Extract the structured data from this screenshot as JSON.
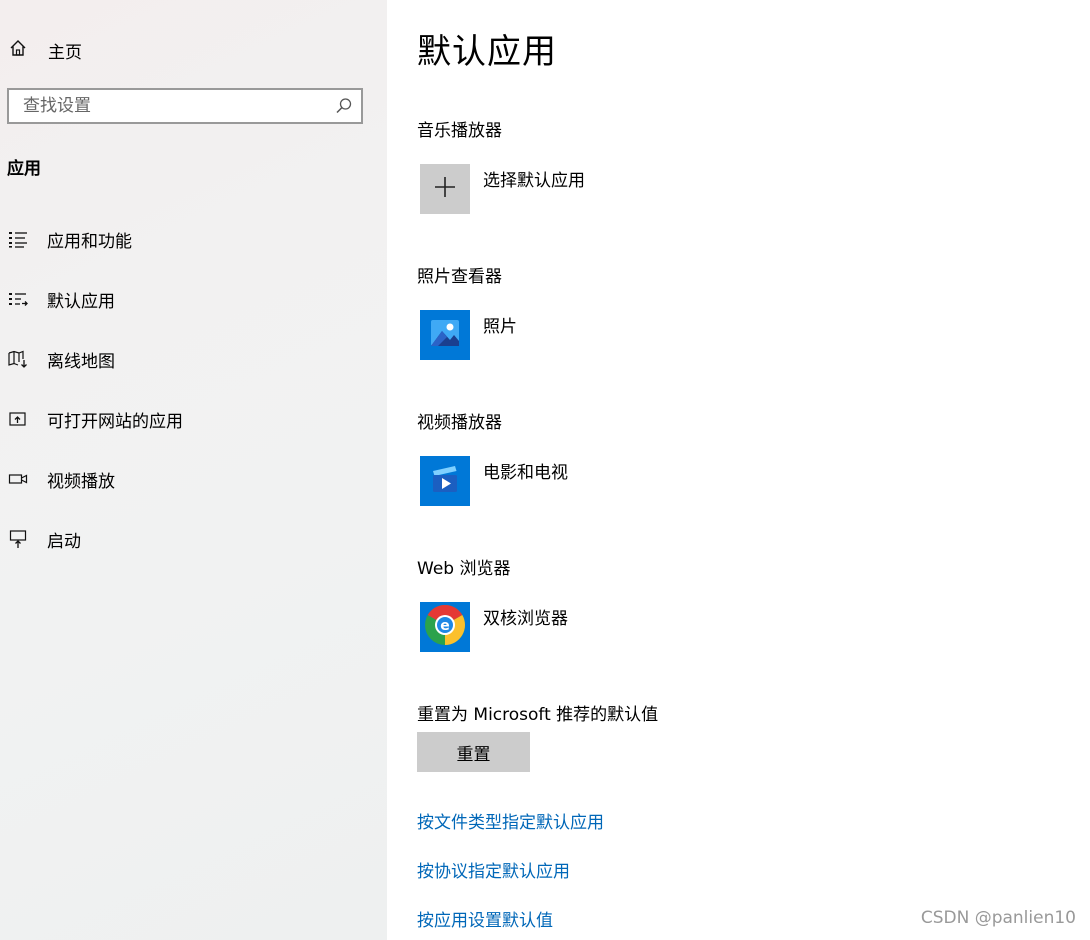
{
  "sidebar": {
    "home_label": "主页",
    "search_placeholder": "查找设置",
    "section_title": "应用",
    "items": [
      {
        "label": "应用和功能"
      },
      {
        "label": "默认应用"
      },
      {
        "label": "离线地图"
      },
      {
        "label": "可打开网站的应用"
      },
      {
        "label": "视频播放"
      },
      {
        "label": "启动"
      }
    ]
  },
  "main": {
    "title": "默认应用",
    "categories": [
      {
        "label": "音乐播放器",
        "app": "选择默认应用",
        "icon": "plus-icon"
      },
      {
        "label": "照片查看器",
        "app": "照片",
        "icon": "photos-app-icon"
      },
      {
        "label": "视频播放器",
        "app": "电影和电视",
        "icon": "movies-tv-app-icon"
      },
      {
        "label": "Web 浏览器",
        "app": "双核浏览器",
        "icon": "browser-app-icon"
      }
    ],
    "reset_label": "重置为 Microsoft 推荐的默认值",
    "reset_button": "重置",
    "links": [
      "按文件类型指定默认应用",
      "按协议指定默认应用",
      "按应用设置默认值"
    ]
  },
  "watermark": "CSDN @panlien10",
  "colors": {
    "accent": "#0078d7",
    "link": "#0067b8",
    "tile_gray": "#cccccc",
    "sidebar_bg": "#f2f2f2"
  }
}
